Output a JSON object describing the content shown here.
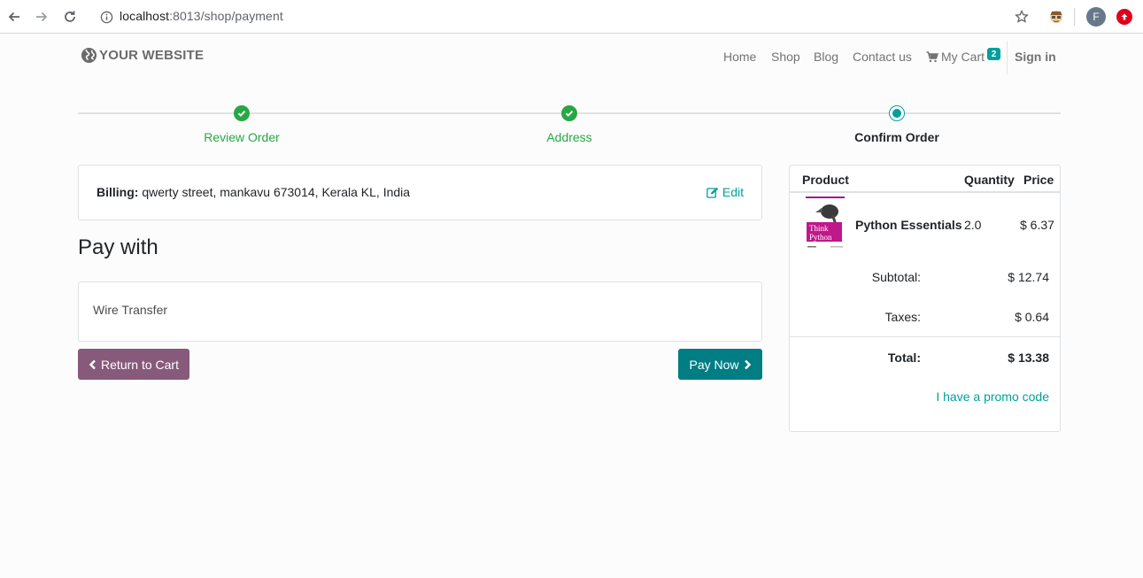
{
  "browser": {
    "url_host": "localhost",
    "url_path": ":8013/shop/payment",
    "avatar_letter": "F"
  },
  "header": {
    "logo_text": "YOUR WEBSITE",
    "menu": [
      {
        "label": "Home"
      },
      {
        "label": "Shop"
      },
      {
        "label": "Blog"
      },
      {
        "label": "Contact us"
      },
      {
        "label": "My Cart"
      }
    ],
    "cart_count": "2",
    "sign_in": "Sign in"
  },
  "progress": {
    "steps": [
      {
        "label": "Review Order",
        "state": "done"
      },
      {
        "label": "Address",
        "state": "done"
      },
      {
        "label": "Confirm Order",
        "state": "current"
      }
    ]
  },
  "billing": {
    "label": "Billing:",
    "address": "qwerty street, mankavu 673014, Kerala KL, India",
    "edit_label": "Edit"
  },
  "payment": {
    "title": "Pay with",
    "methods": [
      {
        "label": "Wire Transfer"
      }
    ],
    "return_label": "Return to Cart",
    "pay_label": "Pay Now"
  },
  "summary": {
    "headers": {
      "product": "Product",
      "quantity": "Quantity",
      "price": "Price"
    },
    "items": [
      {
        "name": "Python Essentials",
        "quantity": "2.0",
        "price": "$ 6.37",
        "cover_text": "Think Python"
      }
    ],
    "subtotal_label": "Subtotal:",
    "subtotal": "$ 12.74",
    "taxes_label": "Taxes:",
    "taxes": "$ 0.64",
    "total_label": "Total:",
    "total": "$ 13.38",
    "promo_label": "I have a promo code"
  },
  "colors": {
    "primary": "#875a7b",
    "accent": "#00a09d",
    "pay_button": "#017e84",
    "success": "#28a745"
  }
}
